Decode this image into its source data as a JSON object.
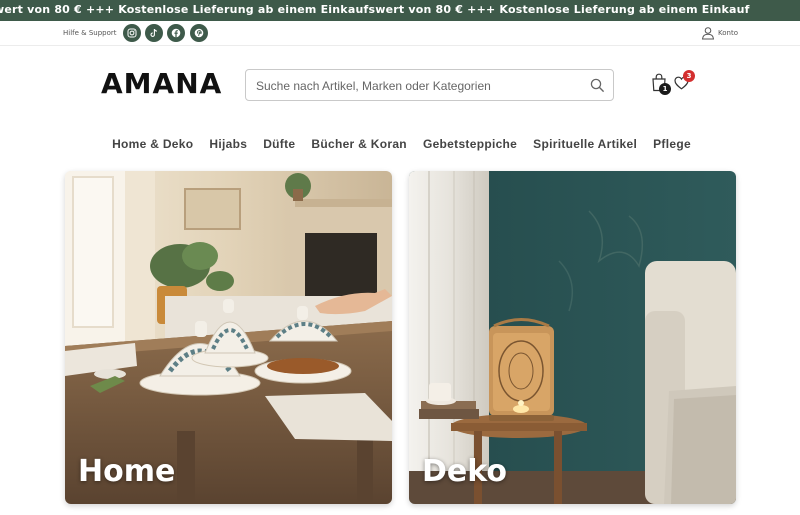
{
  "announcement": {
    "text": "wert von 80 € +++ Kostenlose Lieferung ab einem Einkaufswert von 80 € +++ Kostenlose Lieferung ab einem Einkauf"
  },
  "topbar": {
    "help_label": "Hilfe & Support",
    "social_icons": [
      "instagram-icon",
      "tiktok-icon",
      "facebook-icon",
      "pinterest-icon"
    ],
    "account_label": "Konto"
  },
  "header": {
    "logo": "AMANA",
    "search": {
      "placeholder": "Suche nach Artikel, Marken oder Kategorien",
      "value": ""
    },
    "cart_count": "1",
    "wishlist_count": "3"
  },
  "nav": {
    "items": [
      "Home & Deko",
      "Hijabs",
      "Düfte",
      "Bücher & Koran",
      "Gebetsteppiche",
      "Spirituelle Artikel",
      "Pflege"
    ]
  },
  "categories": [
    {
      "label": "Home"
    },
    {
      "label": "Deko"
    }
  ],
  "colors": {
    "brand_green": "#3e5a4a",
    "badge_red": "#d32f2f",
    "badge_dark": "#1a1a1a"
  }
}
